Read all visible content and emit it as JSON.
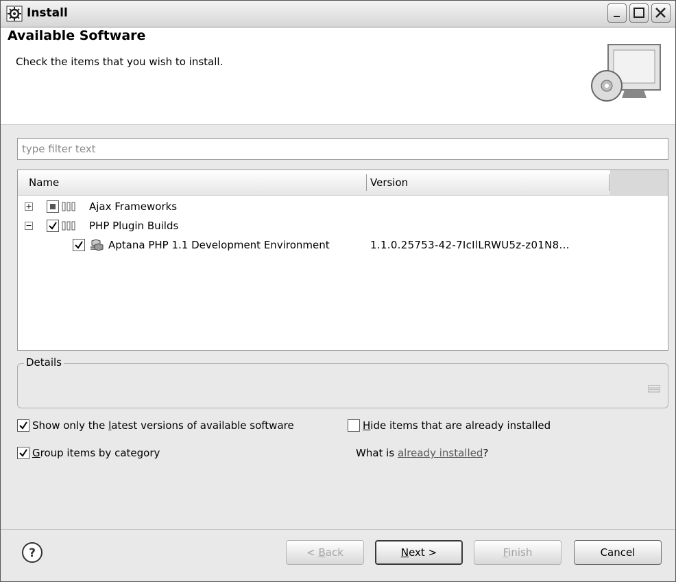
{
  "window": {
    "title": "Install",
    "controls": {
      "minimize": "minimize-icon",
      "maximize": "maximize-icon",
      "close": "close-icon"
    }
  },
  "banner": {
    "title": "Available Software",
    "subtitle": "Check the items that you wish to install.",
    "icon": "install-monitor-icon"
  },
  "filter": {
    "placeholder": "type filter text",
    "value": ""
  },
  "table": {
    "columns": [
      "Name",
      "Version"
    ],
    "rows": [
      {
        "name": "Ajax Frameworks",
        "version": "",
        "expanded": false,
        "checked": "partial",
        "level": 0
      },
      {
        "name": "PHP Plugin Builds",
        "version": "",
        "expanded": true,
        "checked": true,
        "level": 0
      },
      {
        "name": "Aptana PHP 1.1 Development Environment",
        "version": "1.1.0.25753-42-7IcIlLRWU5z-z01N8...",
        "checked": true,
        "level": 1
      }
    ]
  },
  "details": {
    "label": "Details"
  },
  "options": {
    "latest_only": {
      "label_pre": "Show only the ",
      "mnemonic": "l",
      "label_post": "atest versions of available software",
      "checked": true
    },
    "hide_installed": {
      "mnemonic": "H",
      "label_post": "ide items that are already installed",
      "checked": false
    },
    "group_by_category": {
      "mnemonic": "G",
      "label_post": "roup items by category",
      "checked": true
    },
    "installed_prefix": "What is ",
    "installed_link": "already installed",
    "installed_suffix": "?"
  },
  "buttons": {
    "back": {
      "pre": "< ",
      "mn": "B",
      "post": "ack",
      "enabled": false
    },
    "next": {
      "mn": "N",
      "post": "ext >",
      "enabled": true
    },
    "finish": {
      "mn": "F",
      "post": "inish",
      "enabled": false
    },
    "cancel": {
      "label": "Cancel",
      "enabled": true
    }
  }
}
